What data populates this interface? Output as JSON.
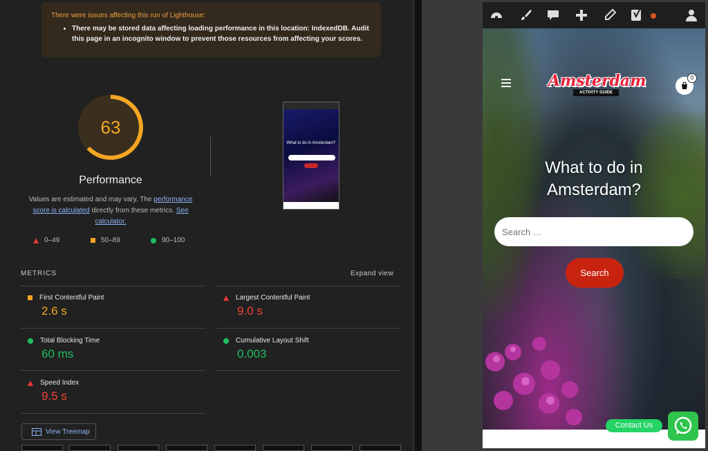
{
  "lighthouse": {
    "warning_title": "There were issues affecting this run of Lighthouse:",
    "warning_item": "There may be stored data affecting loading performance in this location: IndexedDB. Audit this page in an incognito window to prevent those resources from affecting your scores.",
    "score": "63",
    "category_title": "Performance",
    "desc_pre": "Values are estimated and may vary. The ",
    "desc_link1": "performance score is calculated",
    "desc_mid": " directly from these metrics. ",
    "desc_link2": "See calculator.",
    "legend": [
      {
        "range": "0–49",
        "icon": "fail-triangle-icon",
        "color": "#e53935"
      },
      {
        "range": "50–89",
        "icon": "average-square-icon",
        "color": "#f5a623"
      },
      {
        "range": "90–100",
        "icon": "pass-circle-icon",
        "color": "#1fbf60"
      }
    ],
    "thumb_title": "What to do in Amsterdam?",
    "metrics_heading": "METRICS",
    "expand_label": "Expand view",
    "metrics": [
      {
        "label": "First Contentful Paint",
        "value": "2.6 s",
        "status": "average"
      },
      {
        "label": "Largest Contentful Paint",
        "value": "9.0 s",
        "status": "fail"
      },
      {
        "label": "Total Blocking Time",
        "value": "60 ms",
        "status": "pass"
      },
      {
        "label": "Cumulative Layout Shift",
        "value": "0.003",
        "status": "pass"
      },
      {
        "label": "Speed Index",
        "value": "9.5 s",
        "status": "fail"
      }
    ],
    "treemap_label": "View Treemap",
    "colors": {
      "average": "#f5a623",
      "fail": "#f44336",
      "pass": "#1fbf60"
    }
  },
  "preview": {
    "admin_icons": [
      "dashboard-icon",
      "customize-brush-icon",
      "comments-icon",
      "new-plus-icon",
      "edit-pencil-icon",
      "yoast-icon",
      "user-icon"
    ],
    "logo_main": "Amsterdam",
    "logo_sub": "ACTIVITY GUIDE",
    "cart_count": "0",
    "hero_title": "What to do in Amsterdam?",
    "search_placeholder": "Search …",
    "search_button": "Search",
    "contact_label": "Contact Us"
  }
}
